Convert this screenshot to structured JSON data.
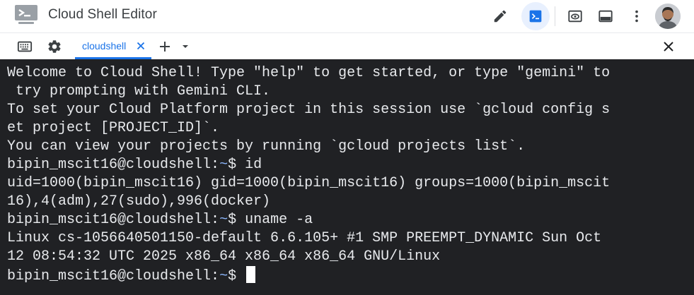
{
  "window": {
    "title": "Cloud Shell Editor"
  },
  "toolbar": {
    "icons": [
      "pencil-icon",
      "terminal-icon",
      "preview-icon",
      "panel-icon",
      "more-vert-icon"
    ],
    "active_icon": "terminal-icon"
  },
  "tabbar": {
    "icons": [
      "keyboard-icon",
      "settings-icon",
      "close-icon"
    ],
    "tabs": [
      {
        "label": "cloudshell",
        "active": true
      }
    ],
    "add_icon": "plus-icon",
    "dropdown_icon": "chevron-down-icon"
  },
  "terminal": {
    "lines": [
      {
        "text": "Welcome to Cloud Shell! Type \"help\" to get started, or type \"gemini\" to"
      },
      {
        "text": " try prompting with Gemini CLI."
      },
      {
        "text": "To set your Cloud Platform project in this session use `gcloud config s"
      },
      {
        "text": "et project [PROJECT_ID]`."
      },
      {
        "text": "You can view your projects by running `gcloud projects list`."
      },
      {
        "prompt_user": "bipin_mscit16@cloudshell:",
        "prompt_dir": "~",
        "prompt_sym": "$ ",
        "command": "id"
      },
      {
        "text": "uid=1000(bipin_mscit16) gid=1000(bipin_mscit16) groups=1000(bipin_mscit"
      },
      {
        "text": "16),4(adm),27(sudo),996(docker)"
      },
      {
        "prompt_user": "bipin_mscit16@cloudshell:",
        "prompt_dir": "~",
        "prompt_sym": "$ ",
        "command": "uname -a"
      },
      {
        "text": "Linux cs-1056640501150-default 6.6.105+ #1 SMP PREEMPT_DYNAMIC Sun Oct"
      },
      {
        "text": "12 08:54:32 UTC 2025 x86_64 x86_64 x86_64 GNU/Linux"
      },
      {
        "prompt_user": "bipin_mscit16@cloudshell:",
        "prompt_dir": "~",
        "prompt_sym": "$ ",
        "command": ""
      }
    ]
  },
  "colors": {
    "terminal_bg": "#202124",
    "terminal_fg": "#e8eaed",
    "prompt_dir": "#8ab4f8",
    "accent": "#1a73e8"
  }
}
